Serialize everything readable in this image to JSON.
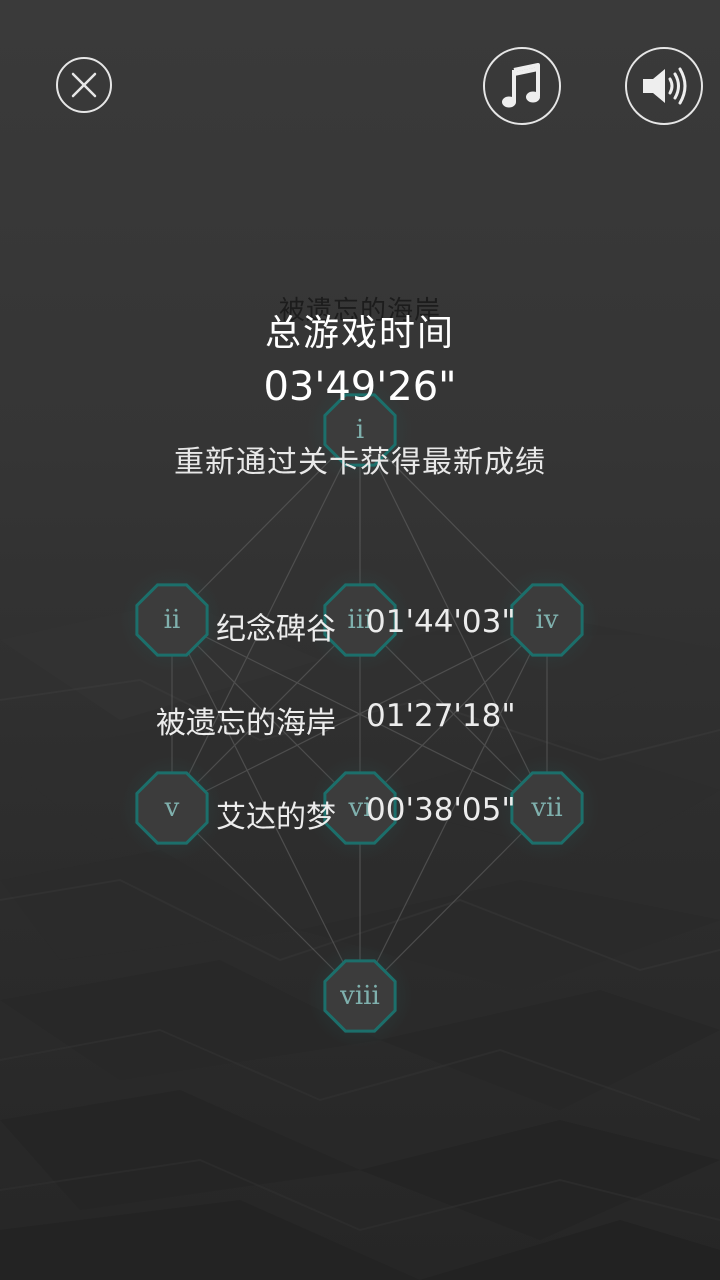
{
  "background_title": "被遗忘的海岸",
  "total": {
    "label": "总游戏时间",
    "value": "03'49'26\""
  },
  "hint": "重新通过关卡获得最新成绩",
  "scores": [
    {
      "name": "纪念碑谷",
      "time": "01'44'03\""
    },
    {
      "name": "被遗忘的海岸",
      "time": "01'27'18\""
    },
    {
      "name": "艾达的梦",
      "time": "00'38'05\""
    }
  ],
  "level_nodes": [
    "i",
    "ii",
    "iii",
    "iv",
    "v",
    "vi",
    "vii",
    "viii"
  ],
  "icons": {
    "close": "close-icon",
    "music": "music-note-icon",
    "sound": "speaker-volume-icon"
  },
  "colors": {
    "node_stroke": "#1c6f6b",
    "node_fill": "#3c3c3c",
    "node_glow": "#2a4f4e",
    "node_text": "#7fb0ad",
    "text": "#ffffff"
  }
}
